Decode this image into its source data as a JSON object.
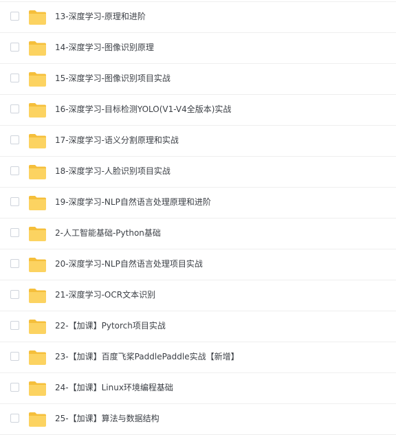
{
  "file_list": {
    "items": [
      {
        "name": "13-深度学习-原理和进阶",
        "icon": "folder-icon"
      },
      {
        "name": "14-深度学习-图像识别原理",
        "icon": "folder-icon"
      },
      {
        "name": "15-深度学习-图像识别项目实战",
        "icon": "folder-icon"
      },
      {
        "name": "16-深度学习-目标检测YOLO(V1-V4全版本)实战",
        "icon": "folder-icon"
      },
      {
        "name": "17-深度学习-语义分割原理和实战",
        "icon": "folder-icon"
      },
      {
        "name": "18-深度学习-人脸识别项目实战",
        "icon": "folder-icon"
      },
      {
        "name": "19-深度学习-NLP自然语言处理原理和进阶",
        "icon": "folder-icon"
      },
      {
        "name": "2-人工智能基础-Python基础",
        "icon": "folder-icon"
      },
      {
        "name": "20-深度学习-NLP自然语言处理项目实战",
        "icon": "folder-icon"
      },
      {
        "name": "21-深度学习-OCR文本识别",
        "icon": "folder-icon"
      },
      {
        "name": "22-【加课】Pytorch项目实战",
        "icon": "folder-icon"
      },
      {
        "name": "23-【加课】百度飞桨PaddlePaddle实战【新增】",
        "icon": "folder-icon"
      },
      {
        "name": "24-【加课】Linux环境编程基础",
        "icon": "folder-icon"
      },
      {
        "name": "25-【加课】算法与数据结构",
        "icon": "folder-icon"
      }
    ]
  },
  "colors": {
    "folder_body": "#fcd361",
    "folder_back": "#f5bf3b",
    "text": "#3b3f45",
    "divider": "#eeeeee",
    "checkbox_border": "#cfd4dc"
  }
}
